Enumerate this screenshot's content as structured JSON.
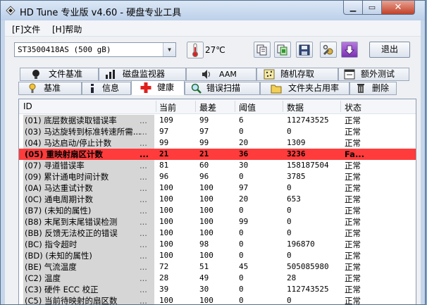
{
  "window": {
    "title": "HD Tune 专业版 v4.60 - 硬盘专业工具",
    "min_icon": "minimize-icon",
    "max_icon": "maximize-icon",
    "close_icon": "close-icon"
  },
  "menu": [
    {
      "label": "[F]文件"
    },
    {
      "label": "[H]帮助"
    }
  ],
  "toolbar": {
    "drive": "ST3500418AS (500 gB)",
    "temperature": "27℃",
    "exit_label": "退出"
  },
  "tabs_row1": [
    {
      "label": "文件基准",
      "icon": "file-benchmark-icon"
    },
    {
      "label": "磁盘监视器",
      "icon": "disk-monitor-icon"
    },
    {
      "label": "AAM",
      "icon": "speaker-icon"
    },
    {
      "label": "随机存取",
      "icon": "random-access-icon"
    },
    {
      "label": "额外测试",
      "icon": "extra-tests-icon"
    }
  ],
  "tabs_row2": [
    {
      "label": "基准",
      "icon": "benchmark-icon"
    },
    {
      "label": "信息",
      "icon": "info-icon"
    },
    {
      "label": "健康",
      "icon": "health-cross-icon"
    },
    {
      "label": "错误扫描",
      "icon": "magnifier-icon"
    },
    {
      "label": "文件夹占用率",
      "icon": "folder-icon"
    },
    {
      "label": "删除",
      "icon": "trash-icon"
    }
  ],
  "table": {
    "headers": {
      "id": "ID",
      "current": "当前",
      "worst": "最差",
      "threshold": "阈值",
      "data": "数据",
      "status": "状态"
    },
    "dots": "...",
    "rows": [
      {
        "id": "(01) 底层数据读取错误率",
        "current": "109",
        "worst": "99",
        "threshold": "6",
        "data": "112743525",
        "status": "正常"
      },
      {
        "id": "(03) 马达旋转到标准转速所需...",
        "current": "97",
        "worst": "97",
        "threshold": "0",
        "data": "0",
        "status": "正常"
      },
      {
        "id": "(04) 马达启动/停止计数",
        "current": "99",
        "worst": "99",
        "threshold": "20",
        "data": "1309",
        "status": "正常"
      },
      {
        "id": "(05) 重映射扇区计数",
        "current": "21",
        "worst": "21",
        "threshold": "36",
        "data": "3236",
        "status": "Fa...",
        "bad": true
      },
      {
        "id": "(07) 寻道错误率",
        "current": "81",
        "worst": "60",
        "threshold": "30",
        "data": "158187504",
        "status": "正常"
      },
      {
        "id": "(09) 累计通电时间计数",
        "current": "96",
        "worst": "96",
        "threshold": "0",
        "data": "3785",
        "status": "正常"
      },
      {
        "id": "(0A) 马达重试计数",
        "current": "100",
        "worst": "100",
        "threshold": "97",
        "data": "0",
        "status": "正常"
      },
      {
        "id": "(0C) 通电周期计数",
        "current": "100",
        "worst": "100",
        "threshold": "20",
        "data": "653",
        "status": "正常"
      },
      {
        "id": "(B7) (未知的属性)",
        "current": "100",
        "worst": "100",
        "threshold": "0",
        "data": "0",
        "status": "正常"
      },
      {
        "id": "(B8) 末尾到末尾错误检测",
        "current": "100",
        "worst": "100",
        "threshold": "99",
        "data": "0",
        "status": "正常"
      },
      {
        "id": "(BB) 反馈无法校正的错误",
        "current": "100",
        "worst": "100",
        "threshold": "0",
        "data": "0",
        "status": "正常"
      },
      {
        "id": "(BC) 指令超时",
        "current": "100",
        "worst": "98",
        "threshold": "0",
        "data": "196870",
        "status": "正常"
      },
      {
        "id": "(BD) (未知的属性)",
        "current": "100",
        "worst": "100",
        "threshold": "0",
        "data": "0",
        "status": "正常"
      },
      {
        "id": "(BE) 气流温度",
        "current": "72",
        "worst": "51",
        "threshold": "45",
        "data": "505085980",
        "status": "正常"
      },
      {
        "id": "(C2) 温度",
        "current": "28",
        "worst": "49",
        "threshold": "0",
        "data": "28",
        "status": "正常"
      },
      {
        "id": "(C3) 硬件 ECC 校正",
        "current": "39",
        "worst": "30",
        "threshold": "0",
        "data": "112743525",
        "status": "正常"
      },
      {
        "id": "(C5) 当前待映射的扇区数",
        "current": "100",
        "worst": "100",
        "threshold": "0",
        "data": "0",
        "status": "正常"
      }
    ]
  }
}
